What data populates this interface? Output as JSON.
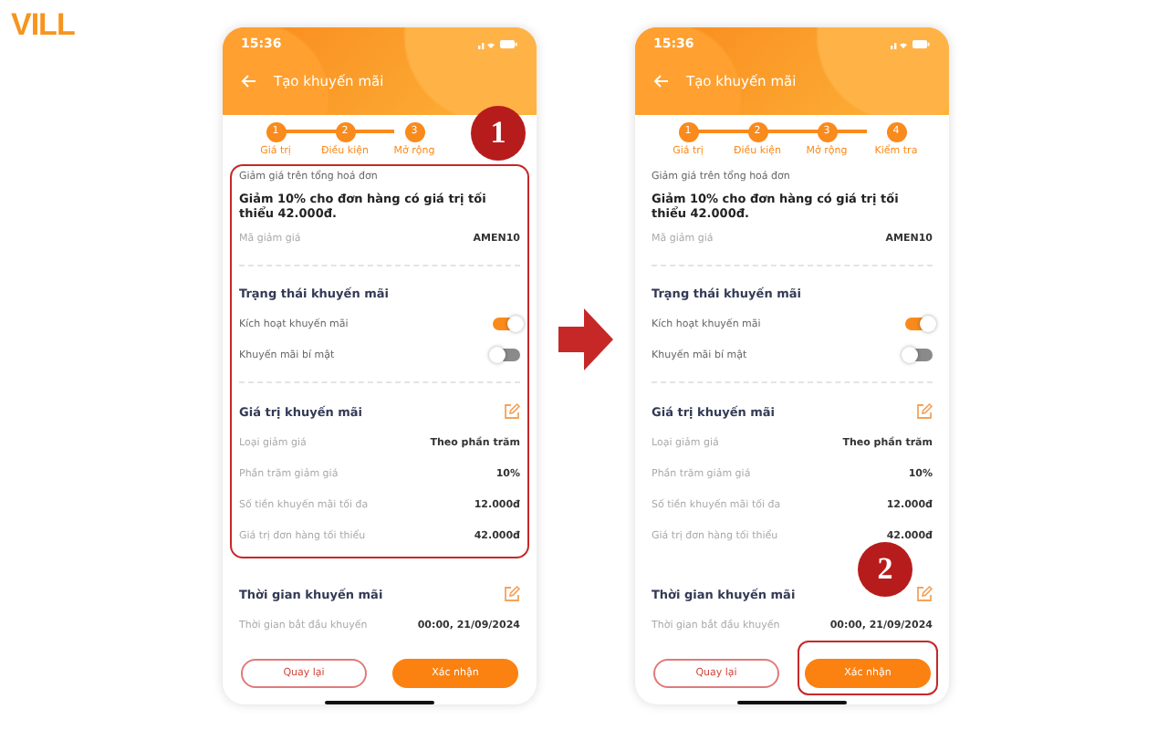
{
  "logo": {
    "text": "VILL"
  },
  "screens": [
    {
      "status_time": "15:36",
      "title": "Tạo khuyến mãi",
      "steps": [
        {
          "number": "1",
          "label": "Giá trị"
        },
        {
          "number": "2",
          "label": "Điều kiện"
        },
        {
          "number": "3",
          "label": "Mở rộng"
        }
      ],
      "summary": {
        "caption": "Giảm giá trên tổng hoá đơn",
        "description": "Giảm 10% cho đơn hàng có giá trị tối thiểu 42.000đ.",
        "code_label": "Mã giảm giá",
        "code": "AMEN10"
      },
      "status_section": {
        "heading": "Trạng thái khuyến mãi",
        "toggles": [
          {
            "label": "Kích hoạt khuyến mãi",
            "on": true
          },
          {
            "label": "Khuyến mãi bí mật",
            "on": false
          }
        ]
      },
      "value_section": {
        "heading": "Giá trị khuyến mãi",
        "rows": [
          {
            "label": "Loại giảm giá",
            "value": "Theo phần trăm"
          },
          {
            "label": "Phần trăm giảm giá",
            "value": "10%"
          },
          {
            "label": "Số tiền khuyến mãi tối đa",
            "value": "12.000đ"
          },
          {
            "label": "Giá trị đơn hàng tối thiểu",
            "value": "42.000đ"
          }
        ]
      },
      "time_section": {
        "heading": "Thời gian khuyến mãi",
        "rows": [
          {
            "label": "Thời gian bắt đầu khuyến",
            "value": "00:00, 21/09/2024"
          }
        ]
      },
      "buttons": [
        {
          "label": "Quay lại",
          "kind": "outline"
        },
        {
          "label": "Xác nhận",
          "kind": "primary"
        }
      ],
      "callout": {
        "number": "1",
        "kind": "content"
      }
    },
    {
      "status_time": "15:36",
      "title": "Tạo khuyến mãi",
      "steps": [
        {
          "number": "1",
          "label": "Giá trị"
        },
        {
          "number": "2",
          "label": "Điều kiện"
        },
        {
          "number": "3",
          "label": "Mở rộng"
        },
        {
          "number": "4",
          "label": "Kiểm tra"
        }
      ],
      "summary": {
        "caption": "Giảm giá trên tổng hoá đơn",
        "description": "Giảm 10% cho đơn hàng có giá trị tối thiểu 42.000đ.",
        "code_label": "Mã giảm giá",
        "code": "AMEN10"
      },
      "status_section": {
        "heading": "Trạng thái khuyến mãi",
        "toggles": [
          {
            "label": "Kích hoạt khuyến mãi",
            "on": true
          },
          {
            "label": "Khuyến mãi bí mật",
            "on": false
          }
        ]
      },
      "value_section": {
        "heading": "Giá trị khuyến mãi",
        "rows": [
          {
            "label": "Loại giảm giá",
            "value": "Theo phần trăm"
          },
          {
            "label": "Phần trăm giảm giá",
            "value": "10%"
          },
          {
            "label": "Số tiền khuyến mãi tối đa",
            "value": "12.000đ"
          },
          {
            "label": "Giá trị đơn hàng tối thiểu",
            "value": "42.000đ"
          }
        ]
      },
      "time_section": {
        "heading": "Thời gian khuyến mãi",
        "rows": [
          {
            "label": "Thời gian bắt đầu khuyến",
            "value": "00:00, 21/09/2024"
          }
        ]
      },
      "buttons": [
        {
          "label": "Quay lại",
          "kind": "outline"
        },
        {
          "label": "Xác nhận",
          "kind": "primary"
        }
      ],
      "callout": {
        "number": "2",
        "kind": "button"
      }
    }
  ]
}
